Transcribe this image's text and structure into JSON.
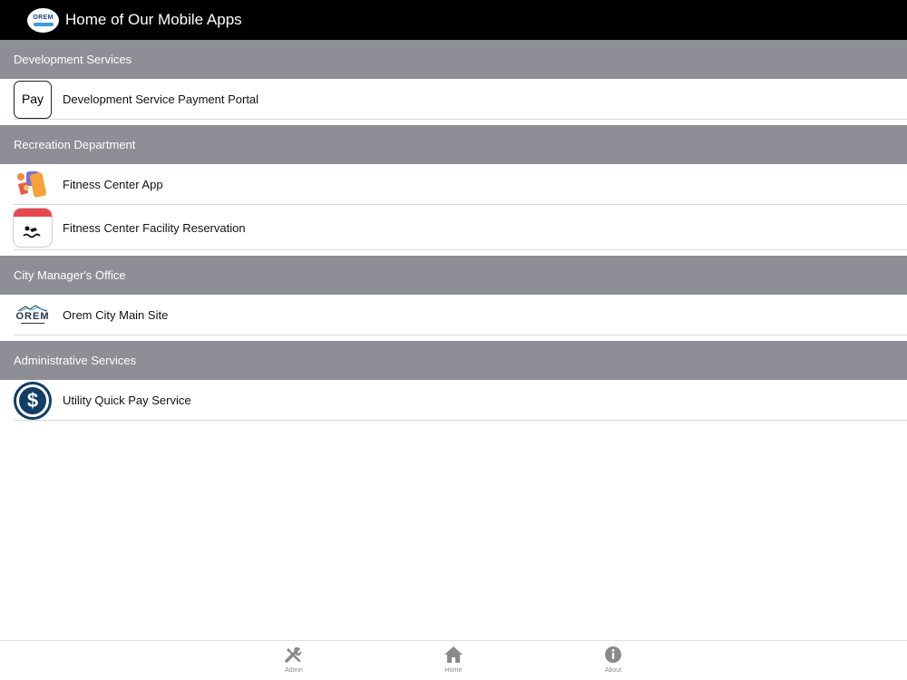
{
  "header": {
    "title": "Home of Our Mobile Apps",
    "logo_text": "OREM"
  },
  "sections": [
    {
      "title": "Development Services",
      "items": [
        {
          "label": "Development Service Payment Portal",
          "icon": "apple-pay-icon",
          "icon_text": "Pay"
        }
      ]
    },
    {
      "title": "Recreation Department",
      "items": [
        {
          "label": "Fitness Center App",
          "icon": "fitness-icon"
        },
        {
          "label": "Fitness Center Facility Reservation",
          "icon": "calendar-swim-icon"
        }
      ]
    },
    {
      "title": "City Manager's Office",
      "items": [
        {
          "label": "Orem City Main Site",
          "icon": "orem-logo-icon",
          "icon_text": "OREM"
        }
      ]
    },
    {
      "title": "Administrative Services",
      "items": [
        {
          "label": "Utility Quick Pay Service",
          "icon": "dollar-icon",
          "icon_text": "$"
        }
      ]
    }
  ],
  "tabbar": {
    "admin": "Admin",
    "home": "Home",
    "about": "About"
  },
  "colors": {
    "header_bg": "#000000",
    "section_bg": "#8e8e96",
    "dollar_blue": "#123d66",
    "calendar_red": "#e5484d"
  }
}
